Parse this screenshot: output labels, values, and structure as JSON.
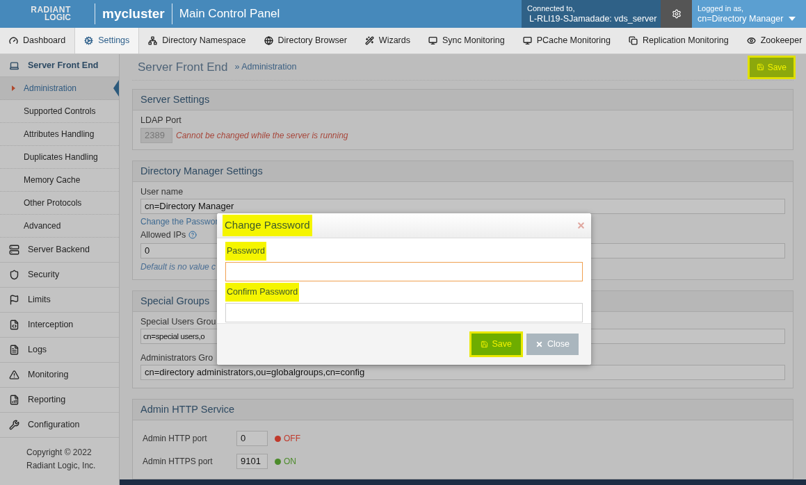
{
  "header": {
    "logo_top": "RADIANT",
    "logo_bottom": "LOGIC",
    "cluster": "mycluster",
    "title": "Main Control Panel",
    "connection": {
      "label": "Connected to,",
      "server": "L-RLI19-SJamadade: vds_server"
    },
    "user": {
      "label": "Logged in as,",
      "name": "cn=Directory Manager"
    }
  },
  "tabs": [
    {
      "label": "Dashboard",
      "selected": false
    },
    {
      "label": "Settings",
      "selected": true
    },
    {
      "label": "Directory Namespace",
      "selected": false
    },
    {
      "label": "Directory Browser",
      "selected": false
    },
    {
      "label": "Wizards",
      "selected": false
    },
    {
      "label": "Sync Monitoring",
      "selected": false
    },
    {
      "label": "PCache Monitoring",
      "selected": false
    },
    {
      "label": "Replication Monitoring",
      "selected": false
    },
    {
      "label": "Zookeeper",
      "selected": false
    }
  ],
  "sidebar": {
    "items": [
      {
        "label": "Server Front End",
        "selected": false,
        "children": [
          {
            "label": "Administration",
            "selected": true
          },
          {
            "label": "Supported Controls",
            "selected": false
          },
          {
            "label": "Attributes Handling",
            "selected": false
          },
          {
            "label": "Duplicates Handling",
            "selected": false
          },
          {
            "label": "Memory Cache",
            "selected": false
          },
          {
            "label": "Other Protocols",
            "selected": false
          },
          {
            "label": "Advanced",
            "selected": false
          }
        ]
      },
      {
        "label": "Server Backend",
        "selected": false
      },
      {
        "label": "Security",
        "selected": false
      },
      {
        "label": "Limits",
        "selected": false
      },
      {
        "label": "Interception",
        "selected": false
      },
      {
        "label": "Logs",
        "selected": false
      },
      {
        "label": "Monitoring",
        "selected": false
      },
      {
        "label": "Reporting",
        "selected": false
      },
      {
        "label": "Configuration",
        "selected": false
      }
    ],
    "copyright": [
      "Copyright © 2022",
      "Radiant Logic, Inc."
    ]
  },
  "main": {
    "breadcrumb": {
      "section": "Server Front End",
      "page": "» Administration"
    },
    "save_button": {
      "label": "Save",
      "highlighted": true
    },
    "server_settings": {
      "title": "Server Settings",
      "ldap_port": {
        "label": "LDAP Port",
        "value": "2389",
        "disabled": true,
        "note": "Cannot be changed while the server is running"
      }
    },
    "directory_manager": {
      "title": "Directory Manager Settings",
      "user_name": {
        "label": "User name",
        "value": "cn=Directory Manager"
      },
      "change_password_link": "Change the Passwor",
      "allowed_ips": {
        "label": "Allowed IPs",
        "value": "0",
        "hint": "Default is no value c"
      }
    },
    "special_groups": {
      "title": "Special Groups",
      "special_users": {
        "label": "Special Users Grou",
        "value": "cn=special users,o"
      },
      "administrators": {
        "label": "Administrators Gro",
        "value": "cn=directory administrators,ou=globalgroups,cn=config"
      }
    },
    "admin_http": {
      "title": "Admin HTTP Service",
      "ports": [
        {
          "label": "Admin HTTP port",
          "value": "0",
          "status": "OFF",
          "on": false
        },
        {
          "label": "Admin HTTPS port",
          "value": "9101",
          "status": "ON",
          "on": true
        }
      ]
    }
  },
  "modal": {
    "title": "Change Password",
    "highlighted": true,
    "fields": [
      {
        "label": "Password",
        "highlighted": true,
        "focused": true
      },
      {
        "label": "Confirm Password",
        "highlighted": true,
        "focused": false
      }
    ],
    "buttons": [
      {
        "kind": "save",
        "label": "Save",
        "highlighted": true
      },
      {
        "kind": "close",
        "label": "Close",
        "highlighted": false
      }
    ]
  }
}
